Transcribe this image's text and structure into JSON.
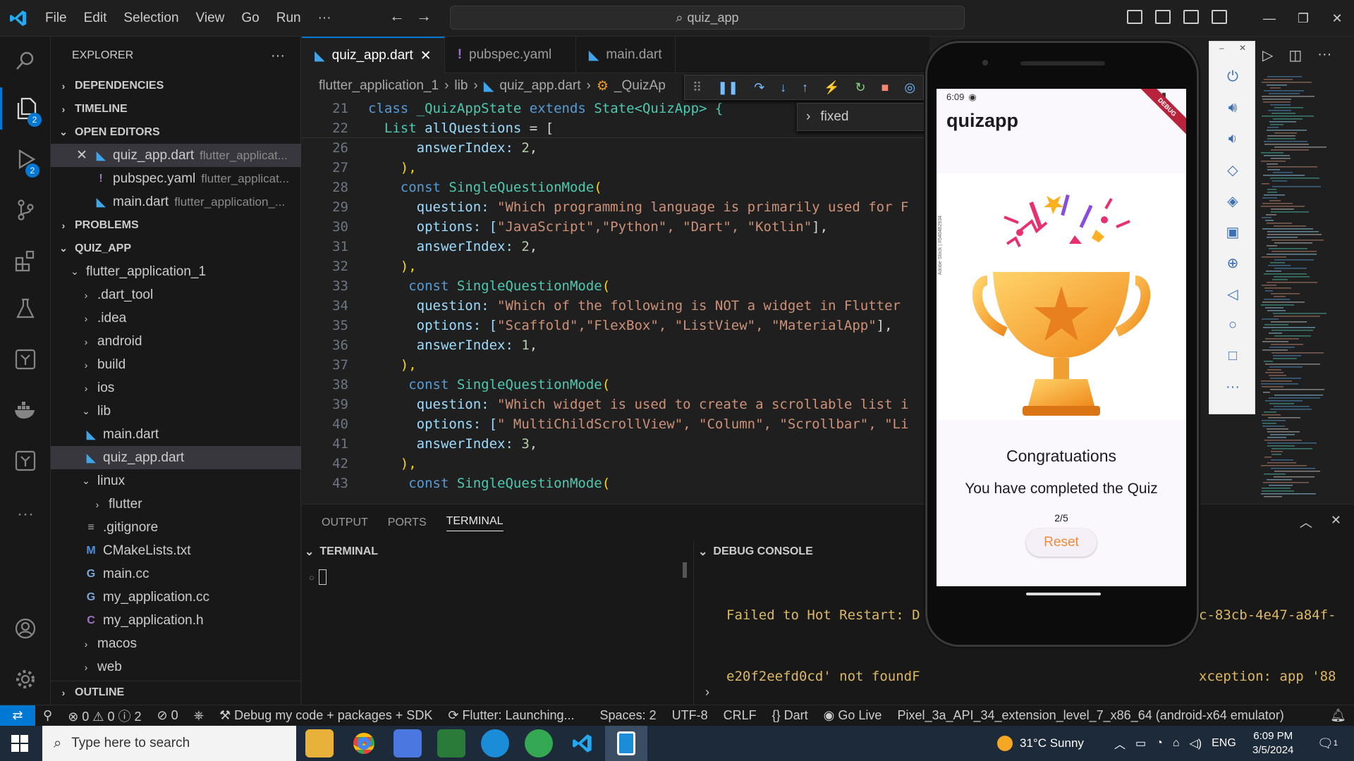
{
  "title_bar": {
    "menus": [
      "File",
      "Edit",
      "Selection",
      "View",
      "Go",
      "Run"
    ],
    "more": "···",
    "search_text": "quiz_app"
  },
  "activity_bar": {
    "explorer_badge": "2",
    "debug_badge": "2"
  },
  "sidebar": {
    "title": "EXPLORER",
    "more": "···",
    "sections": {
      "dependencies": "DEPENDENCIES",
      "timeline": "TIMELINE",
      "open_editors": "OPEN EDITORS",
      "problems": "PROBLEMS",
      "quiz_app": "QUIZ_APP",
      "outline": "OUTLINE"
    },
    "open_editors": [
      {
        "name": "quiz_app.dart",
        "desc": "flutter_applicat..."
      },
      {
        "name": "pubspec.yaml",
        "desc": "flutter_applicat..."
      },
      {
        "name": "main.dart",
        "desc": "flutter_application_..."
      }
    ],
    "tree": {
      "root": "flutter_application_1",
      "dart_tool": ".dart_tool",
      "idea": ".idea",
      "android": "android",
      "build": "build",
      "ios": "ios",
      "lib": "lib",
      "main_dart": "main.dart",
      "quiz_app_dart": "quiz_app.dart",
      "linux": "linux",
      "flutter": "flutter",
      "gitignore": ".gitignore",
      "cmake": "CMakeLists.txt",
      "main_cc": "main.cc",
      "my_app_cc": "my_application.cc",
      "my_app_h": "my_application.h",
      "macos": "macos",
      "web": "web"
    }
  },
  "tabs": [
    {
      "label": "quiz_app.dart"
    },
    {
      "label": "pubspec.yaml"
    },
    {
      "label": "main.dart"
    }
  ],
  "breadcrumb": [
    "flutter_application_1",
    "lib",
    "quiz_app.dart",
    "_QuizAp"
  ],
  "find_widget": {
    "value": "fixed"
  },
  "code": {
    "l21": {
      "n": "21",
      "a": "class ",
      "b": "_QuizAppState",
      "c": " extends ",
      "d": "State",
      "e": "<QuizApp> {"
    },
    "l22": {
      "n": "22",
      "a": "  List ",
      "b": "allQuestions",
      "c": " = ["
    },
    "l26": {
      "n": "26",
      "a": "      answerIndex: ",
      "b": "2",
      "c": ","
    },
    "l27": {
      "n": "27",
      "a": "    ),"
    },
    "l28": {
      "n": "28",
      "a": "    const ",
      "b": "SingleQuestionMode",
      "c": "("
    },
    "l29": {
      "n": "29",
      "a": "      question: ",
      "b": "\"Which programming language is primarily used for F"
    },
    "l30": {
      "n": "30",
      "a": "      options: [",
      "b": "\"JavaScript\",\"Python\", \"Dart\", \"Kotlin\"",
      "c": "],"
    },
    "l31": {
      "n": "31",
      "a": "      answerIndex: ",
      "b": "2",
      "c": ","
    },
    "l32": {
      "n": "32",
      "a": "    ),"
    },
    "l33": {
      "n": "33",
      "a": "     const ",
      "b": "SingleQuestionMode",
      "c": "("
    },
    "l34": {
      "n": "34",
      "a": "      question: ",
      "b": "\"Which of the following is NOT a widget in Flutter"
    },
    "l35": {
      "n": "35",
      "a": "      options: [",
      "b": "\"Scaffold\",\"FlexBox\", \"ListView\", \"MaterialApp\"",
      "c": "],"
    },
    "l36": {
      "n": "36",
      "a": "      answerIndex: ",
      "b": "1",
      "c": ","
    },
    "l37": {
      "n": "37",
      "a": "    ),"
    },
    "l38": {
      "n": "38",
      "a": "     const ",
      "b": "SingleQuestionMode",
      "c": "("
    },
    "l39": {
      "n": "39",
      "a": "      question: ",
      "b": "\"Which widget is used to create a scrollable list i"
    },
    "l40": {
      "n": "40",
      "a": "      options: [",
      "b": "\" MultiChildScrollView\", \"Column\", \"Scrollbar\", \"Li"
    },
    "l41": {
      "n": "41",
      "a": "      answerIndex: ",
      "b": "3",
      "c": ","
    },
    "l42": {
      "n": "42",
      "a": "    ),"
    },
    "l43": {
      "n": "43",
      "a": "     const ",
      "b": "SingleQuestionMode",
      "c": "("
    }
  },
  "panel": {
    "tabs": [
      "OUTPUT",
      "PORTS",
      "TERMINAL"
    ],
    "terminal_section": "TERMINAL",
    "debug_section": "DEBUG CONSOLE",
    "debug_lines": [
      "Failed to Hot Restart: D",
      "e20f2eefd0cd' not foundF",
      "99a41c-83cb-4e47-a84f-e2"
    ],
    "debug_lines_right": [
      "c-83cb-4e47-a84f-",
      "xception: app '88",
      ""
    ]
  },
  "emulator": {
    "time": "6:09",
    "app_title": "quizapp",
    "debug_banner": "DEBUG",
    "congrats": "Congratuations",
    "completed": "You have completed the Quiz",
    "score": "2/5",
    "reset": "Reset",
    "watermark": "Adobe Stock | #540462934"
  },
  "status_bar": {
    "errors": "0",
    "warnings": "0",
    "infos": "2",
    "ports": "0",
    "debug_config": "Debug my code + packages + SDK",
    "flutter_status": "Flutter: Launching...",
    "spaces": "Spaces: 2",
    "encoding": "UTF-8",
    "eol": "CRLF",
    "language": "Dart",
    "go_live": "Go Live",
    "device": "Pixel_3a_API_34_extension_level_7_x86_64 (android-x64 emulator)"
  },
  "taskbar": {
    "search_placeholder": "Type here to search",
    "weather": "31°C  Sunny",
    "lang": "ENG",
    "time": "6:09 PM",
    "date": "3/5/2024",
    "notif_count": "1"
  }
}
